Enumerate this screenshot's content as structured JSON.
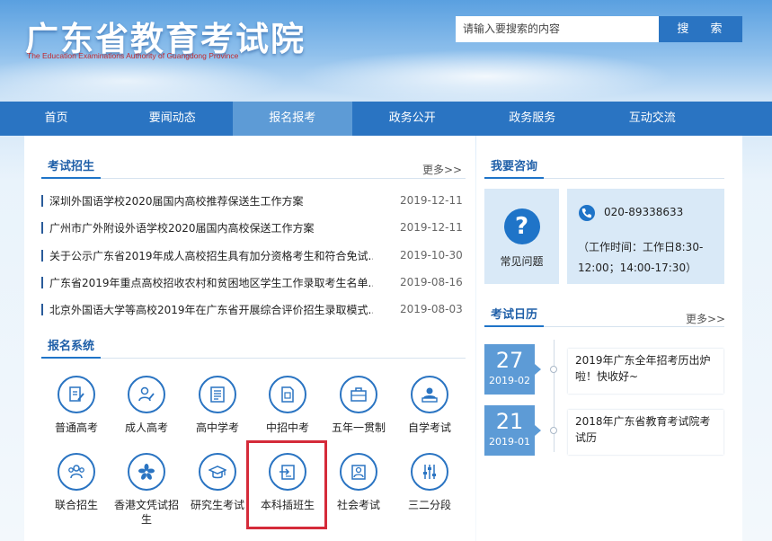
{
  "header": {
    "title": "广东省教育考试院",
    "subtitle": "The Education Examinations Authority of Guangdong Province",
    "search_placeholder": "请输入要搜索的内容",
    "search_button": "搜 索"
  },
  "nav": {
    "items": [
      {
        "label": "首页"
      },
      {
        "label": "要闻动态"
      },
      {
        "label": "报名报考"
      },
      {
        "label": "政务公开"
      },
      {
        "label": "政务服务"
      },
      {
        "label": "互动交流"
      }
    ],
    "active_index": 2
  },
  "exam_admission": {
    "title": "考试招生",
    "more": "更多>>",
    "items": [
      {
        "title": "深圳外国语学校2020届国内高校推荐保送生工作方案",
        "date": "2019-12-11"
      },
      {
        "title": "广州市广外附设外语学校2020届国内高校保送工作方案",
        "date": "2019-12-11"
      },
      {
        "title": "关于公示广东省2019年成人高校招生具有加分资格考生和符合免试...",
        "date": "2019-10-30"
      },
      {
        "title": "广东省2019年重点高校招收农村和贫困地区学生工作录取考生名单...",
        "date": "2019-08-16"
      },
      {
        "title": "北京外国语大学等高校2019年在广东省开展综合评价招生录取模式...",
        "date": "2019-08-03"
      }
    ]
  },
  "registration": {
    "title": "报名系统",
    "items": [
      {
        "label": "普通高考",
        "icon": "document-pen-icon"
      },
      {
        "label": "成人高考",
        "icon": "person-pen-icon"
      },
      {
        "label": "高中学考",
        "icon": "document-list-icon"
      },
      {
        "label": "中招中考",
        "icon": "document-page-icon"
      },
      {
        "label": "五年一贯制",
        "icon": "briefcase-icon"
      },
      {
        "label": "自学考试",
        "icon": "teacher-board-icon"
      },
      {
        "label": "联合招生",
        "icon": "group-icon"
      },
      {
        "label": "香港文凭试招生",
        "icon": "bauhinia-icon"
      },
      {
        "label": "研究生考试",
        "icon": "graduation-cap-icon"
      },
      {
        "label": "本科插班生",
        "icon": "transfer-icon"
      },
      {
        "label": "社会考试",
        "icon": "person-doc-icon"
      },
      {
        "label": "三二分段",
        "icon": "sliders-icon"
      }
    ]
  },
  "consult": {
    "title": "我要咨询",
    "faq_label": "常见问题",
    "faq_icon": "question-icon",
    "phone": "020-89338633",
    "work_time": "（工作时间：工作日8:30-12:00；14:00-17:30）"
  },
  "calendar": {
    "title": "考试日历",
    "more": "更多>>",
    "items": [
      {
        "day": "27",
        "month": "2019-02",
        "text": "2019年广东全年招考历出炉啦！快收好~"
      },
      {
        "day": "21",
        "month": "2019-01",
        "text": "2018年广东省教育考试院考试历"
      }
    ]
  },
  "colors": {
    "primary": "#2a74c2",
    "nav_active": "#5d9bd6",
    "highlight": "#d52b3a"
  }
}
